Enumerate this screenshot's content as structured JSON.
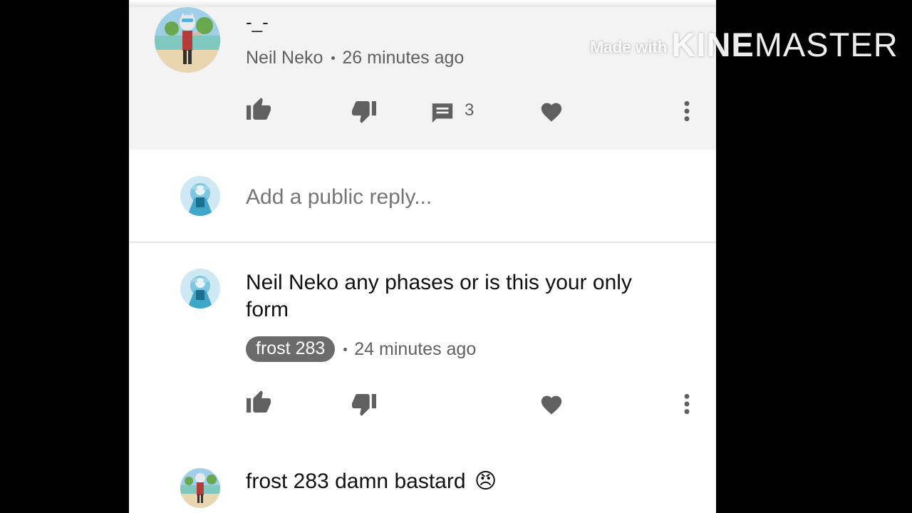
{
  "video_watermark": {
    "made_with": "Made with",
    "brand_strong": "KINE",
    "brand_light": "MASTER"
  },
  "parent_comment": {
    "text": "-_-",
    "author": "Neil Neko",
    "time": "26 minutes ago",
    "reply_count": "3",
    "icons": [
      "thumb-up-icon",
      "thumb-down-icon",
      "reply-icon",
      "heart-icon",
      "more-vert-icon"
    ]
  },
  "reply_box": {
    "placeholder": "Add a public reply..."
  },
  "replies": [
    {
      "text_line1": "Neil Neko any phases or is this your only",
      "text_line2": "form",
      "author": "frost 283",
      "time": "24 minutes ago"
    },
    {
      "text": "frost 283 damn bastard",
      "emoji": "😠"
    }
  ],
  "colors": {
    "highlight_bg": "#f3f3f3",
    "icon": "#606060",
    "author_chip": "#6b6b6b"
  }
}
